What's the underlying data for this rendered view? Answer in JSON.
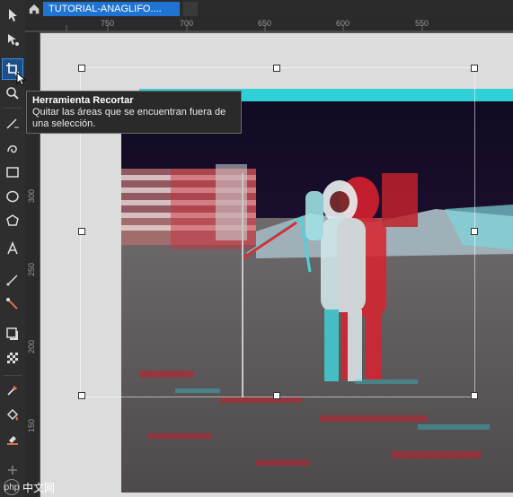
{
  "tabs": {
    "home_icon": "home-icon",
    "document_title": "TUTORIAL-ANAGLIFO...."
  },
  "ruler": {
    "top_ticks": [
      "750",
      "700",
      "650",
      "600",
      "550"
    ],
    "left_ticks": [
      "300",
      "250",
      "200",
      "150"
    ]
  },
  "tooltip": {
    "title": "Herramienta Recortar",
    "description": "Quitar las áreas que se encuentran fuera de una selección."
  },
  "watermark": {
    "logo_text": "php",
    "site": "中文网"
  },
  "tools": [
    {
      "name": "pick-tool-icon"
    },
    {
      "name": "shape-tool-icon"
    },
    {
      "name": "crop-tool-icon",
      "active": true
    },
    {
      "name": "zoom-tool-icon"
    },
    {
      "name": "freehand-tool-icon"
    },
    {
      "name": "smart-drawing-icon"
    },
    {
      "name": "rectangle-tool-icon"
    },
    {
      "name": "ellipse-tool-icon"
    },
    {
      "name": "polygon-tool-icon"
    },
    {
      "name": "text-tool-icon"
    },
    {
      "name": "dimension-tool-icon"
    },
    {
      "name": "connector-tool-icon"
    },
    {
      "name": "drop-shadow-icon"
    },
    {
      "name": "transparency-tool-icon"
    },
    {
      "name": "eyedropper-tool-icon"
    },
    {
      "name": "fill-tool-icon"
    },
    {
      "name": "smart-fill-icon"
    },
    {
      "name": "add-tool-icon"
    }
  ],
  "colors": {
    "accent": "#1f74d3",
    "anaglyph_cyan": "#2fd0d6",
    "anaglyph_red": "#e0212f"
  }
}
